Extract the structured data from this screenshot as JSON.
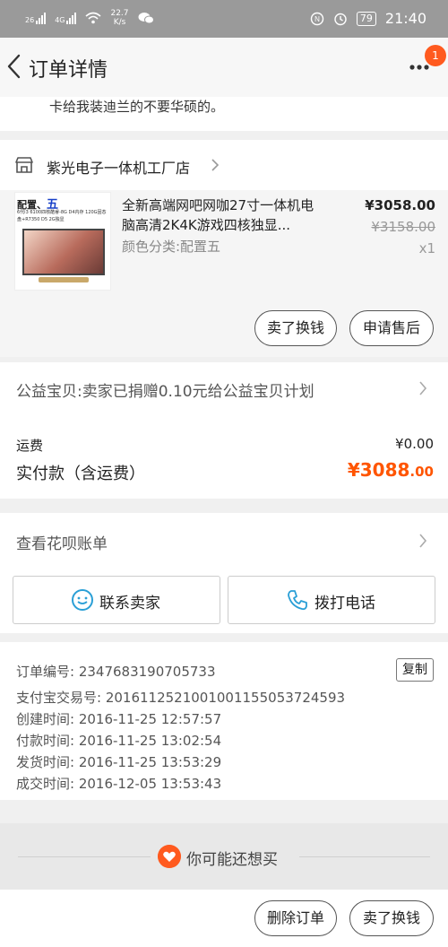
{
  "status_bar": {
    "network_left": "26",
    "network_right": "4G",
    "speed_value": "22.7",
    "speed_unit": "K/s",
    "battery": "79",
    "time": "21:40"
  },
  "nav": {
    "title": "订单详情",
    "badge": "1"
  },
  "address_tail": "卡给我装迪兰的不要华硕的。",
  "shop": {
    "name": "紫光电子一体机工厂店"
  },
  "item": {
    "thumb_title_prefix": "配置、",
    "thumb_title_num": "五",
    "thumb_specs": "6代i3 6100四核酷睿-8G D4内存 120G固态盘+R7350 D5 2G独显",
    "title": "全新高端网吧网咖27寸一体机电脑高清2K4K游戏四核独显...",
    "sku": "颜色分类:配置五",
    "price": "¥3058.00",
    "original_price": "¥3158.00",
    "qty": "x1",
    "btn_sell": "卖了换钱",
    "btn_aftersale": "申请售后"
  },
  "charity": {
    "text": "公益宝贝:卖家已捐赠0.10元给公益宝贝计划"
  },
  "payment": {
    "shipping_label": "运费",
    "shipping_value": "¥0.00",
    "paid_label": "实付款（含运费）",
    "paid_currency": "¥",
    "paid_int": "3088",
    "paid_dec": ".00"
  },
  "huabei": {
    "text": "查看花呗账单"
  },
  "contact": {
    "seller": "联系卖家",
    "phone": "拨打电话"
  },
  "order_info": {
    "order_no": "订单编号: 2347683190705733",
    "copy": "复制",
    "alipay_no": "支付宝交易号: 2016112521001001155053724593",
    "created": "创建时间: 2016-11-25 12:57:57",
    "paid": "付款时间: 2016-11-25 13:02:54",
    "shipped": "发货时间: 2016-11-25 13:53:29",
    "completed": "成交时间: 2016-12-05 13:53:43"
  },
  "may_like": {
    "text": "你可能还想买"
  },
  "bottom": {
    "delete": "删除订单",
    "sell": "卖了换钱"
  },
  "colors": {
    "accent": "#ff5500",
    "badge": "#ff5a1f",
    "contact_icon": "#2a9fd6"
  },
  "icons": [
    "signal-icon",
    "wifi-icon",
    "chat-icon",
    "nfc-icon",
    "alarm-icon",
    "back-arrow-icon",
    "more-dots-icon",
    "shop-icon",
    "chevron-right-icon",
    "smile-chat-icon",
    "phone-icon",
    "heart-icon"
  ]
}
